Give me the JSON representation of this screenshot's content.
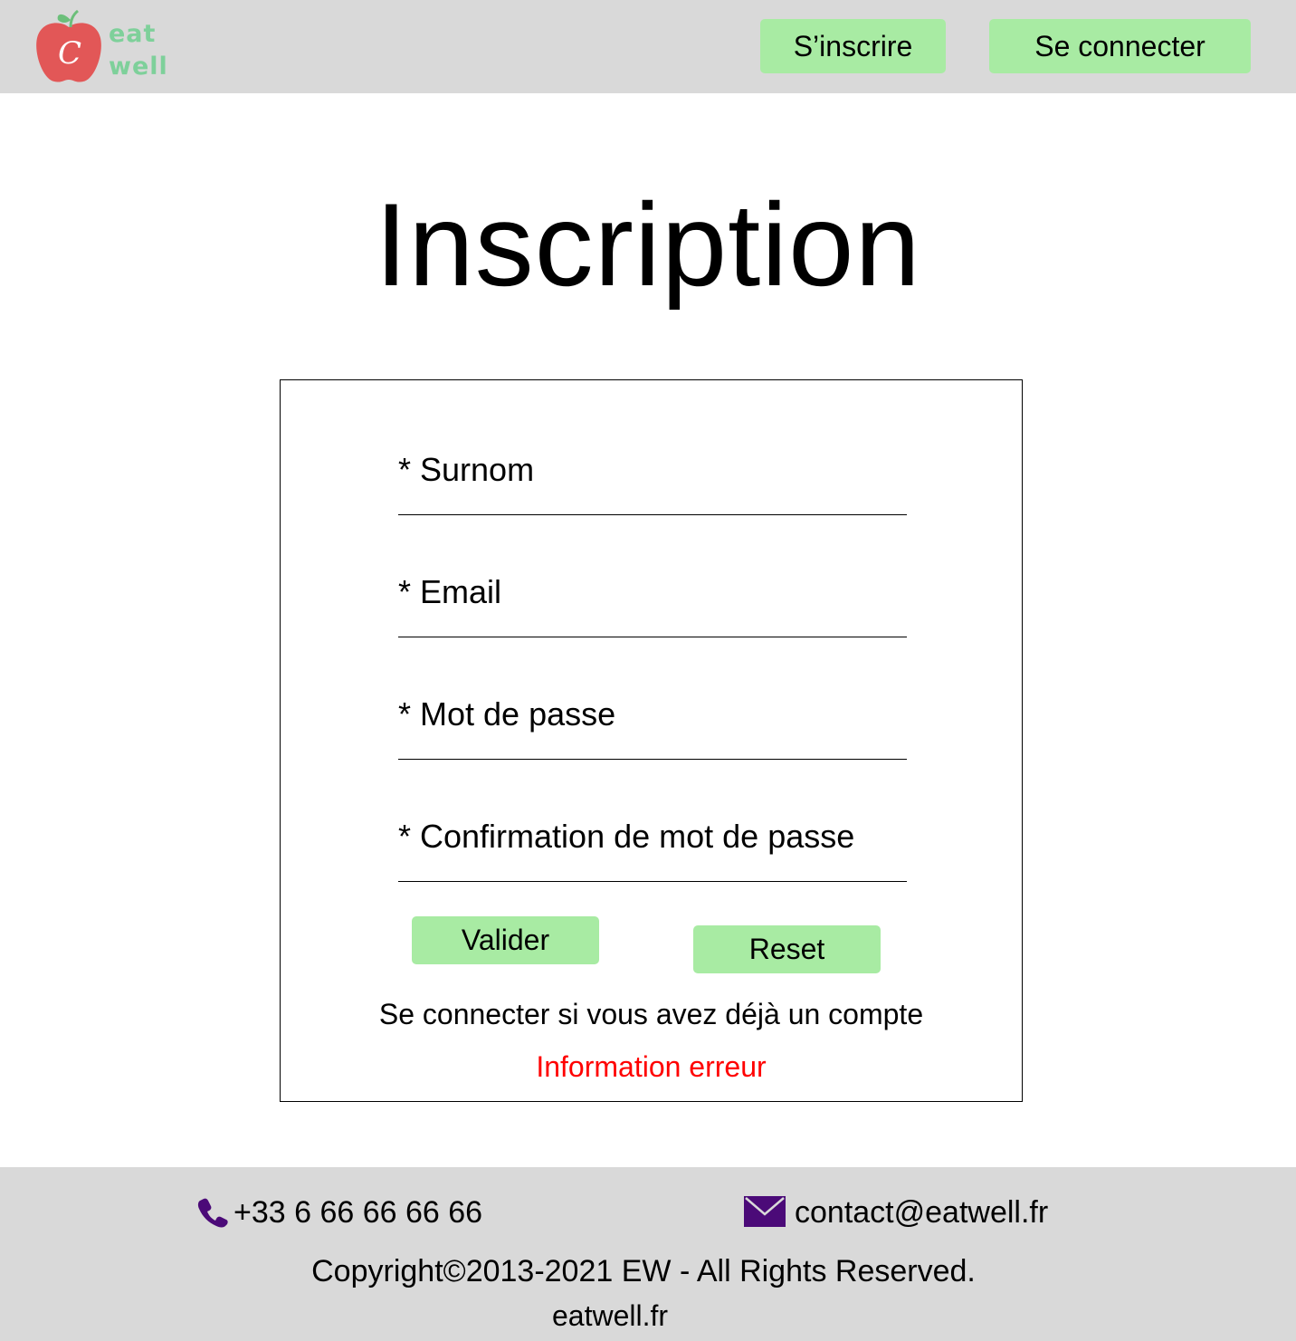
{
  "logo": {
    "line1": "eat",
    "line2": "well",
    "apple_color": "#e25757",
    "text_color": "#7ed09a"
  },
  "header": {
    "signup_label": "S’inscrire",
    "login_label": "Se connecter"
  },
  "main": {
    "title": "Inscription",
    "form": {
      "fields": [
        {
          "label": "* Surnom",
          "value": ""
        },
        {
          "label": "* Email",
          "value": ""
        },
        {
          "label": "* Mot de passe",
          "value": ""
        },
        {
          "label": "* Confirmation de mot de passe",
          "value": ""
        }
      ],
      "submit_label": "Valider",
      "reset_label": "Reset",
      "login_link": "Se connecter si vous avez déjà un compte",
      "error_message": "Information erreur"
    }
  },
  "footer": {
    "phone": "+33 6 66 66 66 66",
    "email": "contact@eatwell.fr",
    "copyright": "Copyright©2013-2021 EW - All Rights Reserved.",
    "site": "eatwell.fr",
    "icon_color": "#4b0a78"
  },
  "colors": {
    "header_bg": "#d9d9d9",
    "button_bg": "#a8eba3",
    "error": "#ff0000"
  },
  "icons": {
    "phone": "phone-icon",
    "mail": "mail-icon",
    "logo": "apple-icon"
  }
}
